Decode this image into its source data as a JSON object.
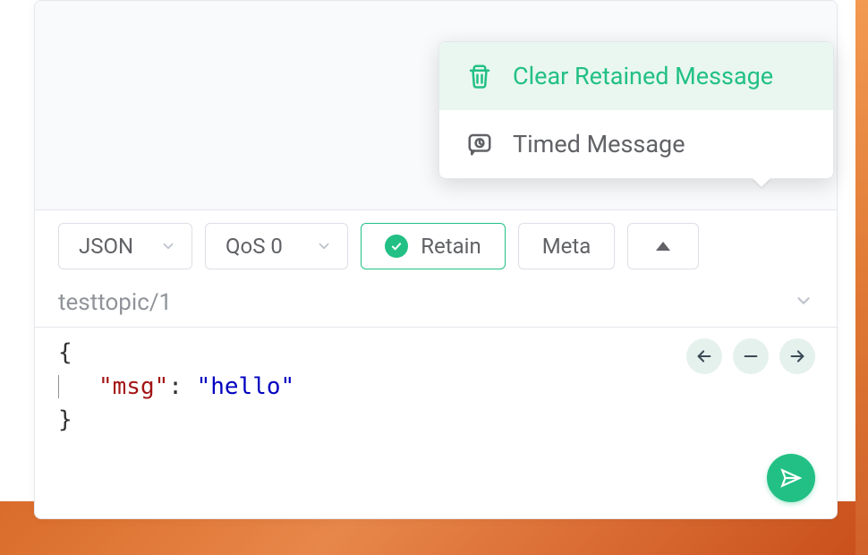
{
  "toolbar": {
    "format": "JSON",
    "qos": "QoS 0",
    "retain": "Retain",
    "meta": "Meta"
  },
  "topic": "testtopic/1",
  "payload": {
    "open_brace": "{",
    "key": "\"msg\"",
    "colon": ":",
    "value": "\"hello\"",
    "close_brace": "}"
  },
  "popover": {
    "clear_retained": "Clear Retained Message",
    "timed_message": "Timed Message"
  }
}
